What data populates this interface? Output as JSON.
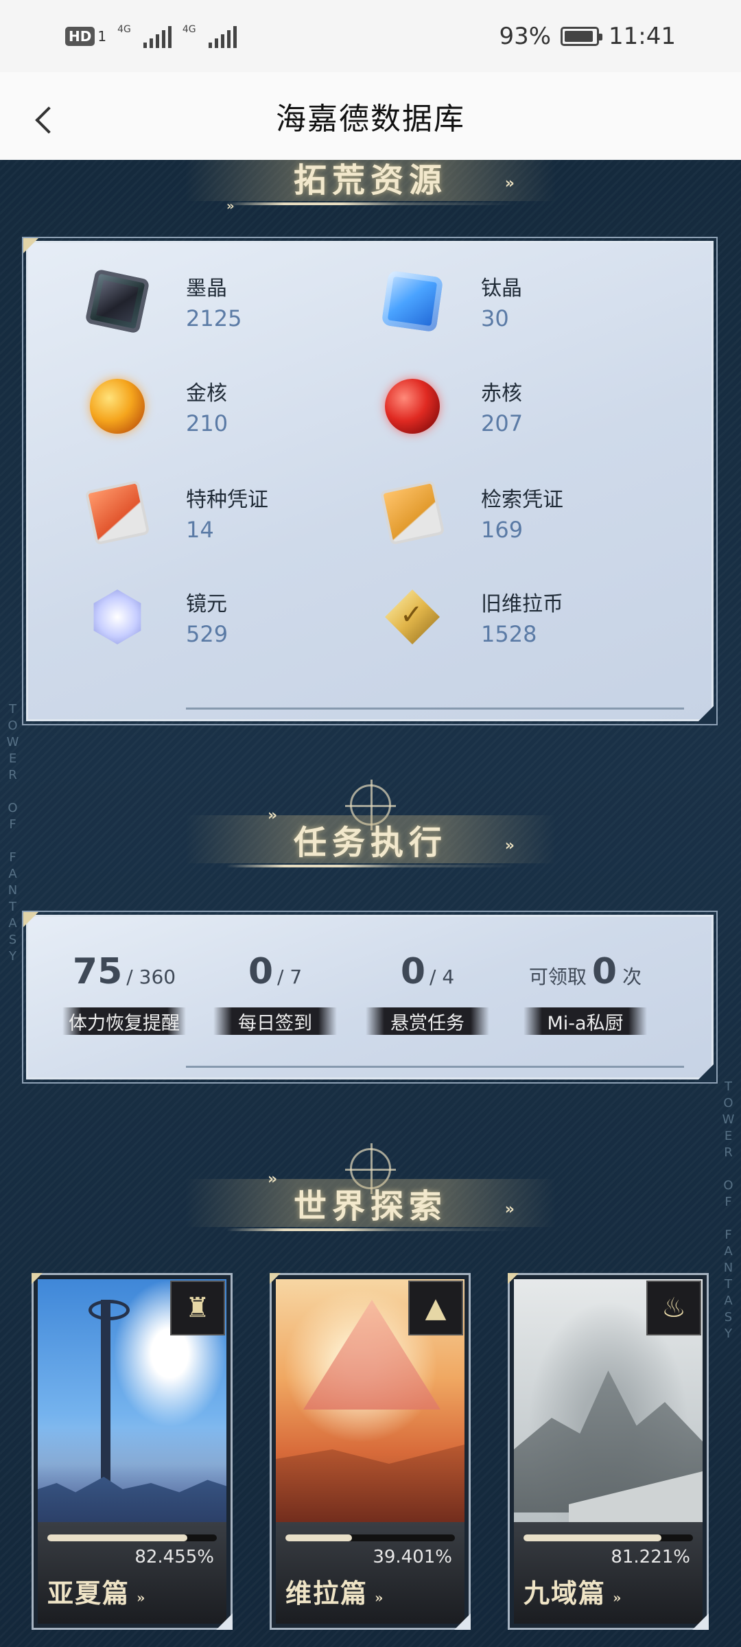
{
  "status_bar": {
    "hd": "HD",
    "sim": "1",
    "net1": "4G",
    "net2": "4G",
    "battery_pct": "93%",
    "battery_level": 0.93,
    "time": "11:41"
  },
  "header": {
    "title": "海嘉德数据库",
    "back_icon": "chevron-left-icon"
  },
  "sections": {
    "resources_title": "拓荒资源",
    "tasks_title": "任务执行",
    "world_title": "世界探索"
  },
  "resources": [
    {
      "name": "墨晶",
      "value": "2125",
      "icon": "dark-crystal-cube-icon"
    },
    {
      "name": "钛晶",
      "value": "30",
      "icon": "blue-crystal-cube-icon"
    },
    {
      "name": "金核",
      "value": "210",
      "icon": "gold-core-orb-icon"
    },
    {
      "name": "赤核",
      "value": "207",
      "icon": "red-core-orb-icon"
    },
    {
      "name": "特种凭证",
      "value": "14",
      "icon": "special-voucher-card-icon"
    },
    {
      "name": "检索凭证",
      "value": "169",
      "icon": "search-voucher-card-icon"
    },
    {
      "name": "镜元",
      "value": "529",
      "icon": "mirror-gem-icon"
    },
    {
      "name": "旧维拉币",
      "value": "1528",
      "icon": "vera-coin-icon"
    }
  ],
  "tasks": [
    {
      "current": "75",
      "total": "/ 360",
      "label": "体力恢复提醒"
    },
    {
      "current": "0",
      "total": "/ 7",
      "label": "每日签到"
    },
    {
      "current": "0",
      "total": "/ 4",
      "label": "悬赏任务"
    },
    {
      "prefix": "可领取",
      "current": "0",
      "suffix": "次",
      "label": "Mi-a私厨"
    }
  ],
  "world": [
    {
      "name": "亚夏篇",
      "percent": "82.455%",
      "progress": 0.82455,
      "emblem": "tower-emblem-icon"
    },
    {
      "name": "维拉篇",
      "percent": "39.401%",
      "progress": 0.39401,
      "emblem": "pyramid-emblem-icon"
    },
    {
      "name": "九域篇",
      "percent": "81.221%",
      "progress": 0.81221,
      "emblem": "flame-crown-emblem-icon"
    }
  ],
  "decor": {
    "side_text_left": "TOWER OF FANTASY",
    "side_text_right": "TOWER OF FANTASY"
  }
}
